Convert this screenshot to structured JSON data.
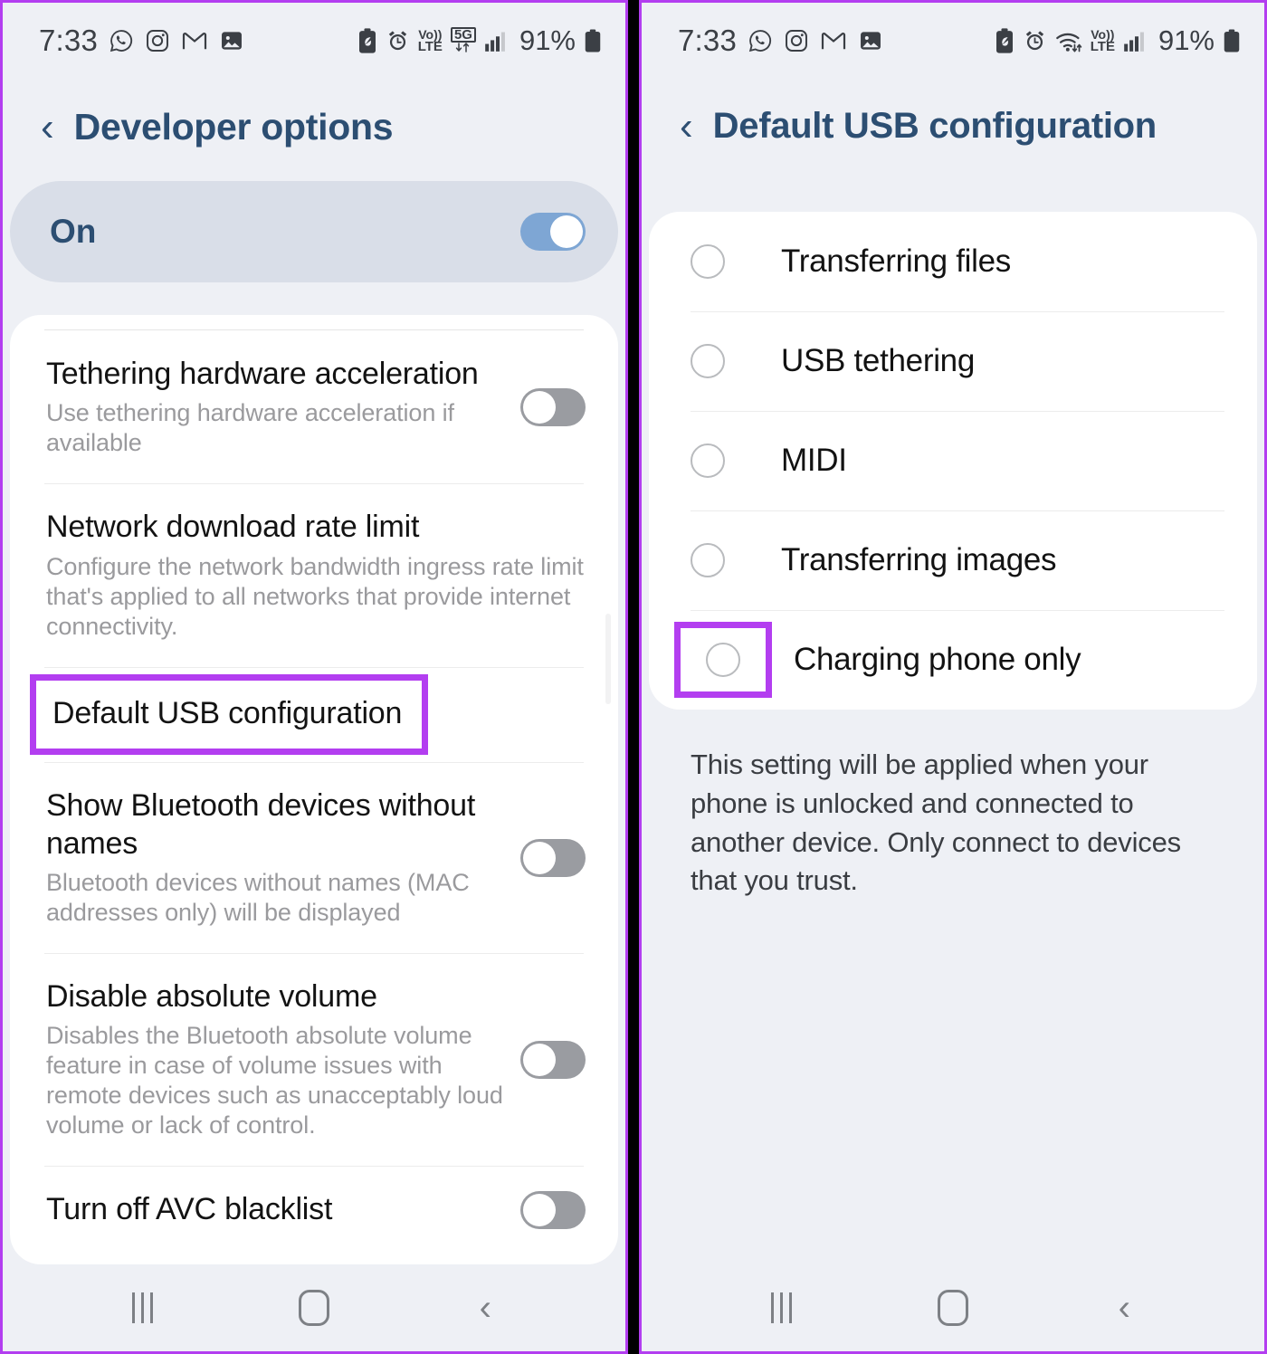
{
  "theme": {
    "highlight_purple": "#b33ef0",
    "header_blue": "#2c4e72",
    "toggle_on_blue": "#7ea6d4",
    "toggle_off_gray": "#9a9ca1",
    "panel_bg": "#eef0f5",
    "card_bg": "#ffffff"
  },
  "left_panel": {
    "statusbar": {
      "time": "7:33",
      "app_icons": [
        "whatsapp-icon",
        "instagram-icon",
        "gmail-icon",
        "gallery-icon"
      ],
      "system_icons": [
        "battery-saver-icon",
        "alarm-icon",
        "volte-icon",
        "5g-icon",
        "signal-bars-icon"
      ],
      "battery_percent": "91%",
      "volte_top": "Vo))",
      "volte_bottom": "LTE",
      "fiveg_label": "5G"
    },
    "header": {
      "back_icon": "chevron-left-icon",
      "title": "Developer options"
    },
    "master_switch": {
      "label": "On",
      "state": "on"
    },
    "rows": [
      {
        "title": "Tethering hardware acceleration",
        "subtitle": "Use tethering hardware acceleration if available",
        "control": "toggle",
        "state": "off",
        "highlighted": false
      },
      {
        "title": "Network download rate limit",
        "subtitle": "Configure the network bandwidth ingress rate limit that's applied to all networks that provide internet connectivity.",
        "control": "none",
        "state": "",
        "highlighted": false
      },
      {
        "title": "Default USB configuration",
        "subtitle": "",
        "control": "none",
        "state": "",
        "highlighted": true
      },
      {
        "title": "Show Bluetooth devices without names",
        "subtitle": "Bluetooth devices without names (MAC addresses only) will be displayed",
        "control": "toggle",
        "state": "off",
        "highlighted": false
      },
      {
        "title": "Disable absolute volume",
        "subtitle": "Disables the Bluetooth absolute volume feature in case of volume issues with remote devices such as unacceptably loud volume or lack of control.",
        "control": "toggle",
        "state": "off",
        "highlighted": false
      },
      {
        "title": "Turn off AVC blacklist",
        "subtitle": "",
        "control": "toggle",
        "state": "off",
        "highlighted": false
      }
    ],
    "navbar": {
      "recents_label": "recents-icon",
      "home_label": "home-icon",
      "back_label": "back-icon"
    }
  },
  "right_panel": {
    "statusbar": {
      "time": "7:33",
      "app_icons": [
        "whatsapp-icon",
        "instagram-icon",
        "gmail-icon",
        "gallery-icon"
      ],
      "system_icons": [
        "battery-saver-icon",
        "alarm-icon",
        "wifi-icon",
        "volte-icon",
        "signal-bars-icon"
      ],
      "battery_percent": "91%",
      "volte_top": "Vo))",
      "volte_bottom": "LTE"
    },
    "header": {
      "back_icon": "chevron-left-icon",
      "title": "Default USB configuration"
    },
    "options": [
      {
        "label": "Transferring files",
        "selected": false,
        "highlighted": false
      },
      {
        "label": "USB tethering",
        "selected": false,
        "highlighted": false
      },
      {
        "label": "MIDI",
        "selected": false,
        "highlighted": false
      },
      {
        "label": "Transferring images",
        "selected": false,
        "highlighted": false
      },
      {
        "label": "Charging phone only",
        "selected": false,
        "highlighted": true
      }
    ],
    "footnote": "This setting will be applied when your phone is unlocked and connected to another device. Only connect to devices that you trust.",
    "navbar": {
      "recents_label": "recents-icon",
      "home_label": "home-icon",
      "back_label": "back-icon"
    }
  }
}
